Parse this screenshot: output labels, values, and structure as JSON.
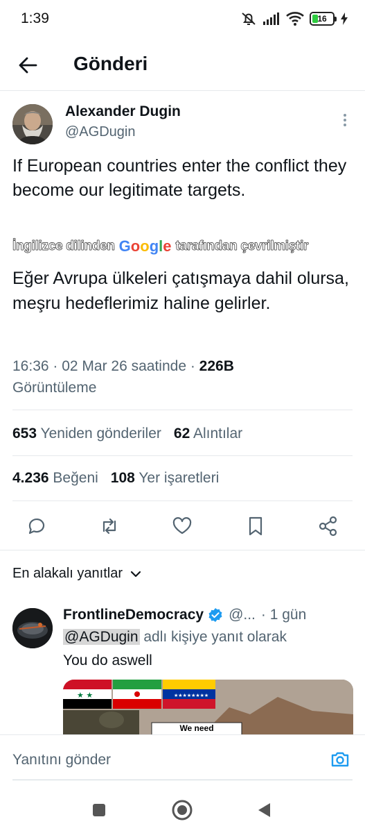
{
  "status_bar": {
    "time": "1:39",
    "battery": "16"
  },
  "header": {
    "title": "Gönderi"
  },
  "tweet": {
    "author_name": "Alexander Dugin",
    "author_handle": "@AGDugin",
    "text": "If European countries enter the conflict they become our legitimate targets.",
    "translated_prefix": "İngilizce dilinden",
    "translated_brand": "Google",
    "translated_suffix": "tarafından çevrilmiştir",
    "translation": "Eğer Avrupa ülkeleri çatışmaya dahil olursa, meşru hedeflerimiz haline gelirler.",
    "timestamp": "16:36 · 02 Mar 26 saatinde · ",
    "views_count": "226B",
    "views_label": "Görüntüleme"
  },
  "stats": {
    "reposts_count": "653",
    "reposts_label": "Yeniden gönderiler",
    "quotes_count": "62",
    "quotes_label": "Alıntılar",
    "likes_count": "4.236",
    "likes_label": "Beğeni",
    "bookmarks_count": "108",
    "bookmarks_label": "Yer işaretleri"
  },
  "replies": {
    "sort_label": "En alakalı yanıtlar",
    "first": {
      "name": "FrontlineDemocracy",
      "handle": "@...",
      "age": "· 1 gün",
      "reply_to_mention": "@AGDugin",
      "reply_to_suffix": " adlı kişiye yanıt olarak",
      "text": "You do aswell",
      "image_caption": "We need"
    }
  },
  "composer": {
    "placeholder": "Yanıtını gönder"
  },
  "colors": {
    "accent": "#1d9bf0",
    "text": "#0f1419",
    "muted": "#536471"
  }
}
